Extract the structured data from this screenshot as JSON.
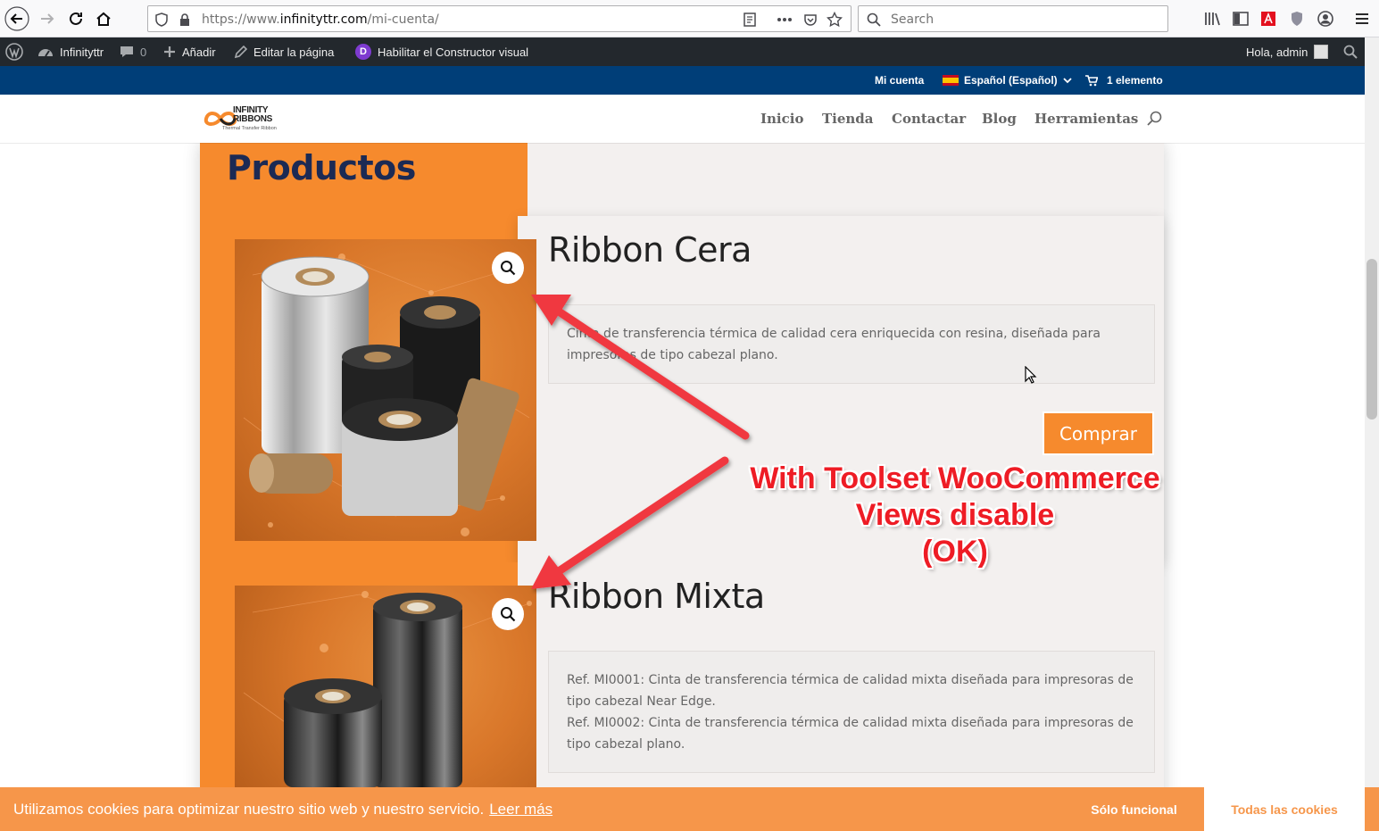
{
  "browser": {
    "url_prefix": "https://www.",
    "url_host": "infinityttr.com",
    "url_path": "/mi-cuenta/",
    "search_placeholder": "Search"
  },
  "wp_admin_bar": {
    "site_name": "Infinityttr",
    "comments_count": "0",
    "add_label": "Añadir",
    "edit_label": "Editar la página",
    "divi_letter": "D",
    "builder_label": "Habilitar el Constructor visual",
    "greeting": "Hola, admin"
  },
  "top_bar": {
    "account": "Mi cuenta",
    "language": "Español (Español)",
    "cart": "1 elemento"
  },
  "header": {
    "logo_line1": "INFINITY",
    "logo_line2": "RIBBONS",
    "logo_tagline": "Thermal Transfer Ribbon",
    "menu": [
      "Inicio",
      "Tienda",
      "Contactar",
      "Blog",
      "Herramientas"
    ]
  },
  "page": {
    "title": "Productos"
  },
  "products": [
    {
      "title": "Ribbon Cera",
      "description": [
        "Cinta de transferencia térmica de calidad cera enriquecida con resina, diseñada para impresoras de tipo cabezal plano."
      ],
      "buy_label": "Comprar"
    },
    {
      "title": "Ribbon Mixta",
      "description": [
        "Ref. MI0001: Cinta de transferencia térmica de calidad mixta diseñada para impresoras de tipo cabezal Near Edge.",
        "Ref. MI0002: Cinta de transferencia térmica de calidad mixta diseñada para impresoras de tipo cabezal plano."
      ]
    }
  ],
  "annotation": {
    "line1": "With Toolset WooCommerce",
    "line2": "Views disable",
    "line3": "(OK)"
  },
  "cookie": {
    "message": "Utilizamos cookies para optimizar nuestro sitio web y nuestro servicio.",
    "link": "Leer más",
    "functional": "Sólo funcional",
    "all": "Todas las cookies"
  },
  "colors": {
    "orange": "#f68a2d",
    "navy": "#003e78",
    "wp_bar": "#23282d",
    "annotation_red": "#ee1c25",
    "title_navy": "#1c2a54"
  }
}
